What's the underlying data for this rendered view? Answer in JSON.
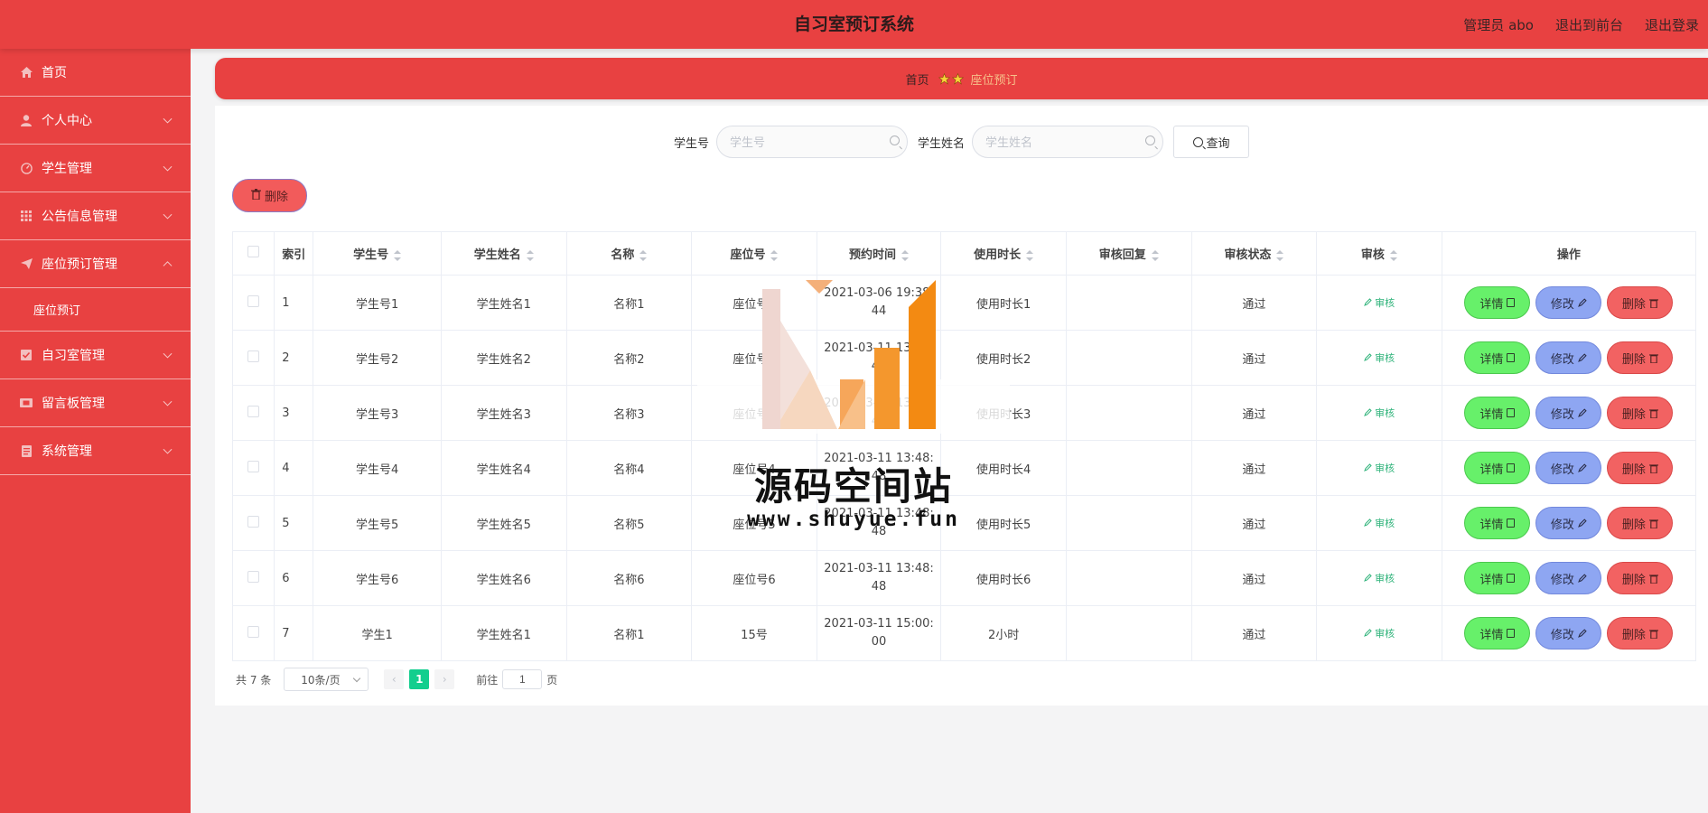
{
  "header": {
    "title": "自习室预订系统",
    "admin_label": "管理员 abo",
    "front_link": "退出到前台",
    "logout_link": "退出登录"
  },
  "sidebar": {
    "items": [
      {
        "label": "首页",
        "icon": "home-icon"
      },
      {
        "label": "个人中心",
        "icon": "user-icon"
      },
      {
        "label": "学生管理",
        "icon": "dashboard-icon"
      },
      {
        "label": "公告信息管理",
        "icon": "grid-icon"
      },
      {
        "label": "座位预订管理",
        "icon": "send-icon"
      },
      {
        "label": "座位预订",
        "icon": ""
      },
      {
        "label": "自习室管理",
        "icon": "checked-icon"
      },
      {
        "label": "留言板管理",
        "icon": "film-icon"
      },
      {
        "label": "系统管理",
        "icon": "doc-icon"
      }
    ]
  },
  "breadcrumb": {
    "home": "首页",
    "current": "座位预订"
  },
  "search": {
    "student_no_label": "学生号",
    "student_no_placeholder": "学生号",
    "student_name_label": "学生姓名",
    "student_name_placeholder": "学生姓名",
    "query_button": "查询"
  },
  "toolbar": {
    "delete_label": "删除"
  },
  "table": {
    "headers": [
      "索引",
      "学生号",
      "学生姓名",
      "名称",
      "座位号",
      "预约时间",
      "使用时长",
      "审核回复",
      "审核状态",
      "审核",
      "操作"
    ],
    "audit_link": "审核",
    "detail_label": "详情",
    "edit_label": "修改",
    "delete_label": "删除",
    "rows": [
      {
        "index": "1",
        "student_no": "学生号1",
        "student_name": "学生姓名1",
        "name": "名称1",
        "seat": "座位号1",
        "time_line1": "2021-03-06 19:38:",
        "time_line2": "44",
        "duration": "使用时长1",
        "reply": "",
        "status": "通过"
      },
      {
        "index": "2",
        "student_no": "学生号2",
        "student_name": "学生姓名2",
        "name": "名称2",
        "seat": "座位号2",
        "time_line1": "2021-03-11 13:48:",
        "time_line2": "48",
        "duration": "使用时长2",
        "reply": "",
        "status": "通过"
      },
      {
        "index": "3",
        "student_no": "学生号3",
        "student_name": "学生姓名3",
        "name": "名称3",
        "seat": "座位号3",
        "time_line1": "2021-03-11 13:48:",
        "time_line2": "48",
        "duration": "使用时长3",
        "reply": "",
        "status": "通过"
      },
      {
        "index": "4",
        "student_no": "学生号4",
        "student_name": "学生姓名4",
        "name": "名称4",
        "seat": "座位号4",
        "time_line1": "2021-03-11 13:48:",
        "time_line2": "48",
        "duration": "使用时长4",
        "reply": "",
        "status": "通过"
      },
      {
        "index": "5",
        "student_no": "学生号5",
        "student_name": "学生姓名5",
        "name": "名称5",
        "seat": "座位号5",
        "time_line1": "2021-03-11 13:48:",
        "time_line2": "48",
        "duration": "使用时长5",
        "reply": "",
        "status": "通过"
      },
      {
        "index": "6",
        "student_no": "学生号6",
        "student_name": "学生姓名6",
        "name": "名称6",
        "seat": "座位号6",
        "time_line1": "2021-03-11 13:48:",
        "time_line2": "48",
        "duration": "使用时长6",
        "reply": "",
        "status": "通过"
      },
      {
        "index": "7",
        "student_no": "学生1",
        "student_name": "学生姓名1",
        "name": "名称1",
        "seat": "15号",
        "time_line1": "2021-03-11 15:00:",
        "time_line2": "00",
        "duration": "2小时",
        "reply": "",
        "status": "通过"
      }
    ]
  },
  "pagination": {
    "total": "共 7 条",
    "page_size": "10条/页",
    "current_page": "1",
    "goto_prefix": "前往",
    "goto_value": "1",
    "goto_suffix": "页"
  },
  "watermark": {
    "title": "源码空间站",
    "url": "www.shuyue.fun"
  },
  "colors": {
    "primary": "#e84141",
    "success": "#67f06a",
    "edit": "#8ea6f2",
    "danger": "#f26262",
    "pager_active": "#13ce8e"
  }
}
